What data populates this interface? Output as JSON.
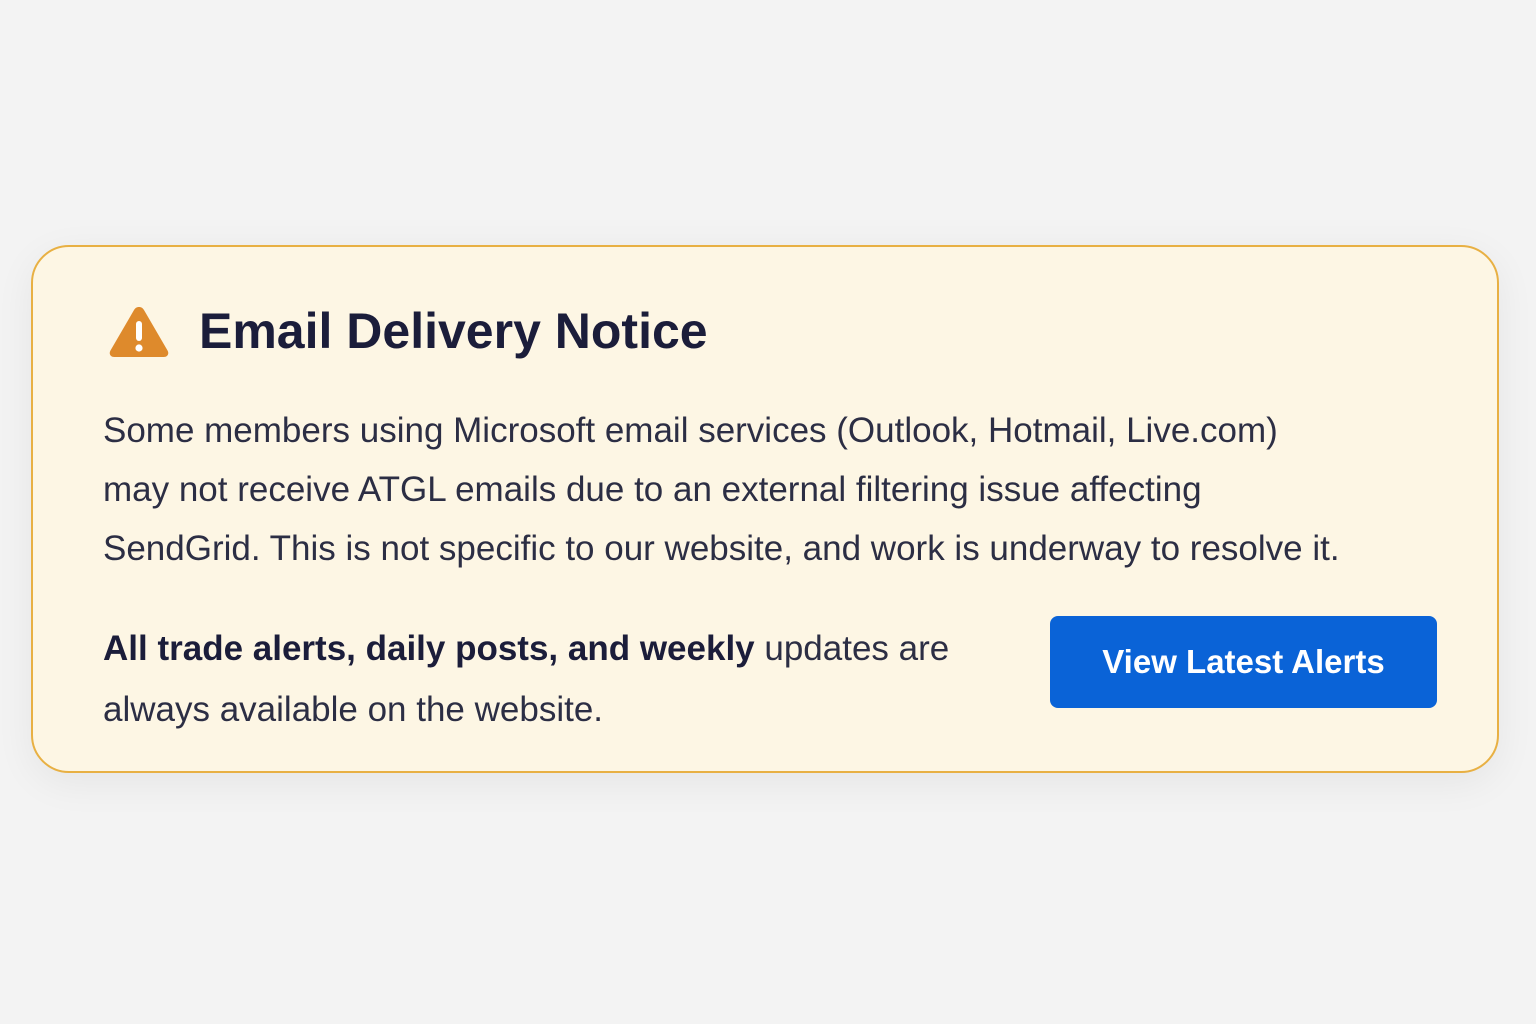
{
  "notice": {
    "icon": "warning-icon",
    "icon_color": "#de8a2c",
    "title": "Email Delivery Notice",
    "body_lines": [
      "Some members using Microsoft email services (Outlook, Hotmail, Live.com)",
      "may not receive ATGL emails due to an external filtering issue affecting",
      "SendGrid. This is not specific to our website, and work is underway to resolve it."
    ],
    "availability": {
      "bold_text": "All trade alerts, daily posts, and weekly",
      "regular_text_line1": "updates are",
      "regular_text_line2": "always available on the website."
    },
    "button_label": "View Latest Alerts"
  },
  "colors": {
    "page_background": "#f3f3f3",
    "card_background": "#fdf6e4",
    "card_border": "#e8b043",
    "title_text": "#1b1d3a",
    "body_text": "#2c2e44",
    "button_background": "#0a63d7",
    "button_text": "#ffffff"
  }
}
